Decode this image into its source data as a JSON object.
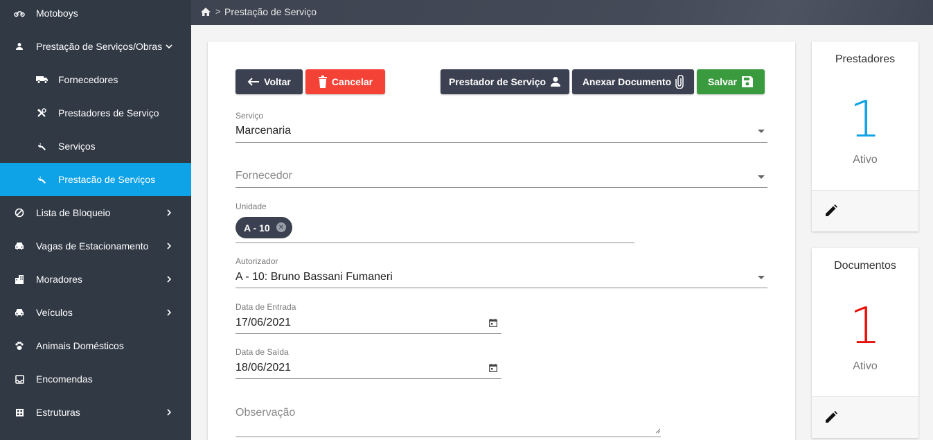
{
  "sidebar": {
    "items": [
      {
        "label": "Motoboys",
        "icon": "motorcycle-icon"
      },
      {
        "label": "Prestação de Serviços/Obras",
        "icon": "person-icon"
      },
      {
        "label": "Fornecedores",
        "icon": "truck-icon"
      },
      {
        "label": "Prestadores de Serviço",
        "icon": "tools-icon"
      },
      {
        "label": "Serviços",
        "icon": "wrench-icon"
      },
      {
        "label": "Prestacão de Serviços",
        "icon": "wrench-icon"
      },
      {
        "label": "Lista de Bloqueio",
        "icon": "block-icon"
      },
      {
        "label": "Vagas de Estacionamento",
        "icon": "car-icon"
      },
      {
        "label": "Moradores",
        "icon": "building-icon"
      },
      {
        "label": "Veículos",
        "icon": "car-icon"
      },
      {
        "label": "Animais Domésticos",
        "icon": "paw-icon"
      },
      {
        "label": "Encomendas",
        "icon": "inbox-icon"
      },
      {
        "label": "Estruturas",
        "icon": "grid-icon"
      }
    ],
    "active_color": "#0ea2e6"
  },
  "breadcrumb": {
    "page": "Prestação de Serviço"
  },
  "toolbar": {
    "back_label": "Voltar",
    "cancel_label": "Cancelar",
    "provider_label": "Prestador de Serviço",
    "attach_label": "Anexar Documento",
    "save_label": "Salvar"
  },
  "form": {
    "service": {
      "label": "Serviço",
      "value": "Marcenaria"
    },
    "supplier": {
      "placeholder": "Fornecedor"
    },
    "unit": {
      "label": "Unidade",
      "chip": "A - 10"
    },
    "authorizer": {
      "label": "Autorizador",
      "value": "A - 10: Bruno Bassani Fumaneri"
    },
    "entry_date": {
      "label": "Data de Entrada",
      "value": "17/06/2021"
    },
    "exit_date": {
      "label": "Data de Saída",
      "value": "18/06/2021"
    },
    "notes": {
      "placeholder": "Observação"
    }
  },
  "stats": {
    "providers": {
      "title": "Prestadores",
      "count": "1",
      "status": "Ativo",
      "color": "#0ea2e6"
    },
    "documents": {
      "title": "Documentos",
      "count": "1",
      "status": "Ativo",
      "color": "#e8110b"
    }
  }
}
